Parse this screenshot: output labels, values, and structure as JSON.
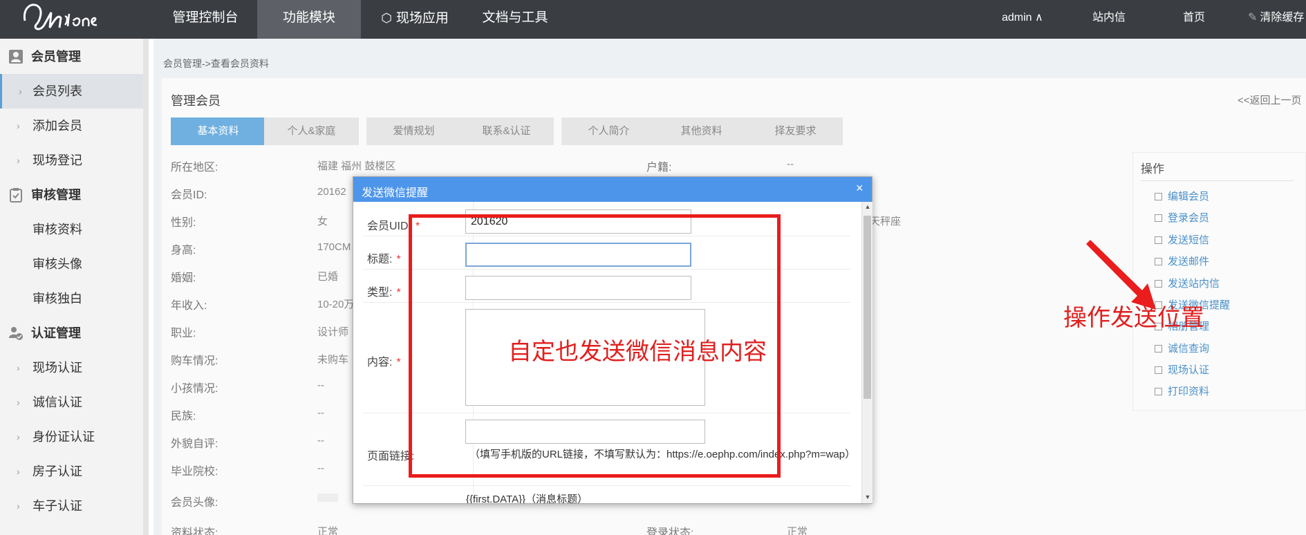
{
  "topbar": {
    "nav": [
      "管理控制台",
      "功能模块",
      "现场应用",
      "文档与工具"
    ],
    "user": "admin ∧",
    "message": "站内信",
    "home": "首页",
    "clear_cache": "清除缓存"
  },
  "sidebar": {
    "groups": [
      {
        "title": "会员管理",
        "icon": "member-icon",
        "items": [
          "会员列表",
          "添加会员",
          "现场登记"
        ]
      },
      {
        "title": "审核管理",
        "icon": "clipboard-icon",
        "items": [
          "审核资料",
          "审核头像",
          "审核独白"
        ]
      },
      {
        "title": "认证管理",
        "icon": "verified-user-icon",
        "items": [
          "现场认证",
          "诚信认证",
          "身份证认证",
          "房子认证",
          "车子认证"
        ]
      }
    ],
    "active_item": "会员列表"
  },
  "main": {
    "breadcrumb": "会员管理->查看会员资料",
    "title": "管理会员",
    "back": "<<返回上一页",
    "tabs": [
      "基本资料",
      "个人&家庭",
      "爱情规划",
      "联系&认证",
      "个人简介",
      "其他资料",
      "择友要求"
    ],
    "active_tab": "基本资料",
    "info_left": [
      {
        "label": "所在地区:",
        "value": "福建 福州 鼓楼区"
      },
      {
        "label": "会员ID:",
        "value": "20162"
      },
      {
        "label": "性别:",
        "value": "女"
      },
      {
        "label": "身高:",
        "value": "170CM"
      },
      {
        "label": "婚姻:",
        "value": "已婚"
      },
      {
        "label": "年收入:",
        "value": "10-20万"
      },
      {
        "label": "职业:",
        "value": "设计师"
      },
      {
        "label": "购车情况:",
        "value": "未购车"
      },
      {
        "label": "小孩情况:",
        "value": "--"
      },
      {
        "label": "民族:",
        "value": "--"
      },
      {
        "label": "外貌自评:",
        "value": "--"
      },
      {
        "label": "毕业院校:",
        "value": "--"
      },
      {
        "label": "会员头像:",
        "value": ""
      },
      {
        "label": "资料状态:",
        "value": "正常"
      }
    ],
    "info_right": [
      {
        "label": "户籍:",
        "value": "--"
      },
      {
        "label": "",
        "value": "天秤座"
      },
      {
        "label": "登录状态:",
        "value": "正常"
      }
    ]
  },
  "ops": {
    "title": "操作",
    "items": [
      "编辑会员",
      "登录会员",
      "发送短信",
      "发送邮件",
      "发送站内信",
      "发送微信提醒",
      "相册管理",
      "诚信查询",
      "现场认证",
      "打印资料"
    ]
  },
  "modal": {
    "title": "发送微信提醒",
    "close": "×",
    "fields": {
      "uid_label": "会员UID:",
      "uid_value": "201620",
      "title_label": "标题:",
      "type_label": "类型:",
      "content_label": "内容:",
      "link_label": "页面链接:",
      "link_hint": "（填写手机版的URL链接，不填写默认为：https://e.oephp.com/index.php?m=wap）",
      "template_line": "{{first.DATA}}（消息标题）"
    }
  },
  "annotations": {
    "content_note": "自定也发送微信消息内容",
    "ops_note": "操作发送位置"
  },
  "colors": {
    "topbar": "#3a3d42",
    "accent_blue": "#4d95ea",
    "annotation_red": "#e0201f",
    "active_tab": "#6fb0e0"
  }
}
